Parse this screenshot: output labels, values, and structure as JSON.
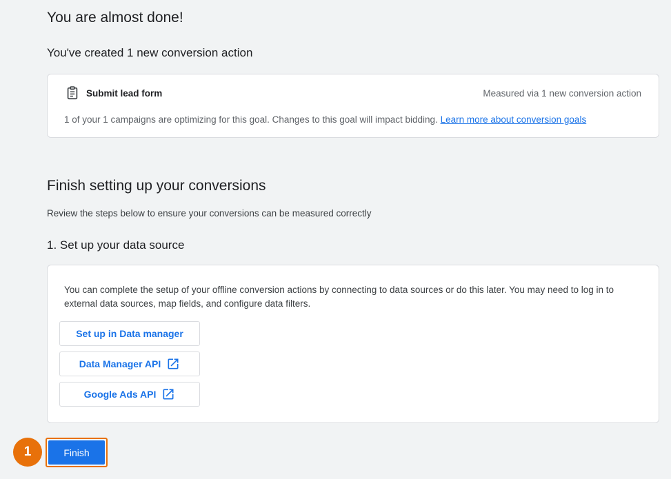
{
  "page": {
    "title": "You are almost done!",
    "created_heading": "You've created 1 new conversion action"
  },
  "goal_card": {
    "icon": "clipboard-icon",
    "name": "Submit lead form",
    "measured": "Measured via 1 new conversion action",
    "description": "1 of your 1 campaigns are optimizing for this goal. Changes to this goal will impact bidding.",
    "link_text": "Learn more about conversion goals"
  },
  "finish_section": {
    "heading": "Finish setting up your conversions",
    "subtitle": "Review the steps below to ensure your conversions can be measured correctly",
    "step1_heading": "1. Set up your data source"
  },
  "data_source_card": {
    "description": "You can complete the setup of your offline conversion actions by connecting to data sources or do this later. You may need to log in to external data sources, map fields, and configure data filters.",
    "buttons": [
      {
        "label": "Set up in Data manager",
        "icon": null
      },
      {
        "label": "Data Manager API",
        "icon": "open-in-new-icon"
      },
      {
        "label": "Google Ads API",
        "icon": "open-in-new-icon"
      }
    ]
  },
  "footer": {
    "step_badge": "1",
    "finish_label": "Finish"
  },
  "colors": {
    "accent": "#1a73e8",
    "highlight": "#e8710a",
    "background": "#f1f3f4"
  }
}
